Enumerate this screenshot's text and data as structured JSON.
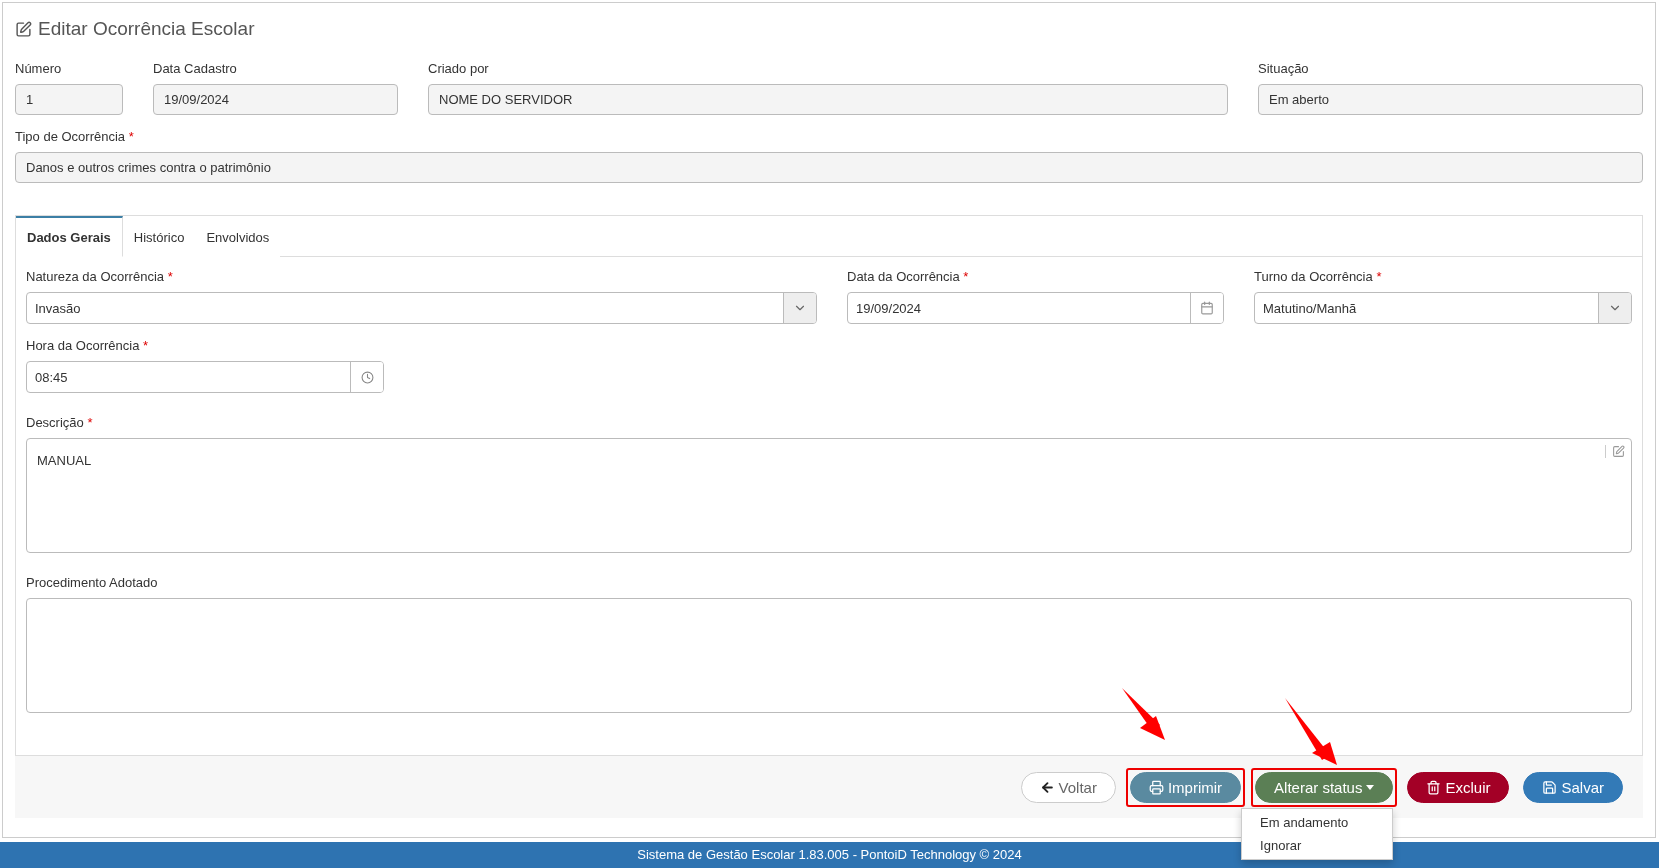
{
  "title": "Editar Ocorrência Escolar",
  "top_fields": [
    {
      "label": "Número",
      "value": "1"
    },
    {
      "label": "Data Cadastro",
      "value": "19/09/2024"
    },
    {
      "label": "Criado por",
      "value": "NOME DO SERVIDOR"
    },
    {
      "label": "Situação",
      "value": "Em aberto"
    }
  ],
  "tipo": {
    "label": "Tipo de Ocorrência",
    "required_mark": "*",
    "value": "Danos e outros crimes contra o patrimônio"
  },
  "tabs": [
    {
      "label": "Dados Gerais",
      "selected": true
    },
    {
      "label": "Histórico",
      "selected": false
    },
    {
      "label": "Envolvidos",
      "selected": false
    }
  ],
  "tab_fields": [
    {
      "label": "Natureza da Ocorrência",
      "required_mark": "*",
      "value": "Invasão",
      "kind": "select"
    },
    {
      "label": "Data da Ocorrência",
      "required_mark": "*",
      "value": "19/09/2024",
      "kind": "date"
    },
    {
      "label": "Turno da Ocorrência",
      "required_mark": "*",
      "value": "Matutino/Manhã",
      "kind": "select"
    }
  ],
  "hora": {
    "label": "Hora da Ocorrência",
    "required_mark": "*",
    "value": "08:45"
  },
  "descricao": {
    "label": "Descrição",
    "required_mark": "*",
    "value": "MANUAL"
  },
  "procedimento": {
    "label": "Procedimento Adotado"
  },
  "buttons": [
    {
      "label": "Voltar",
      "kind": "back",
      "highlighted": false
    },
    {
      "label": "Imprimir",
      "kind": "print",
      "highlighted": true
    },
    {
      "label": "Alterar status",
      "kind": "status",
      "highlighted": true,
      "expanded": true,
      "menu": [
        "Em andamento",
        "Ignorar"
      ]
    },
    {
      "label": "Excluir",
      "kind": "delete",
      "highlighted": false
    },
    {
      "label": "Salvar",
      "kind": "save",
      "highlighted": false
    }
  ],
  "footer": "Sistema de Gestão Escolar 1.83.005 - PontoiD Technology © 2024"
}
